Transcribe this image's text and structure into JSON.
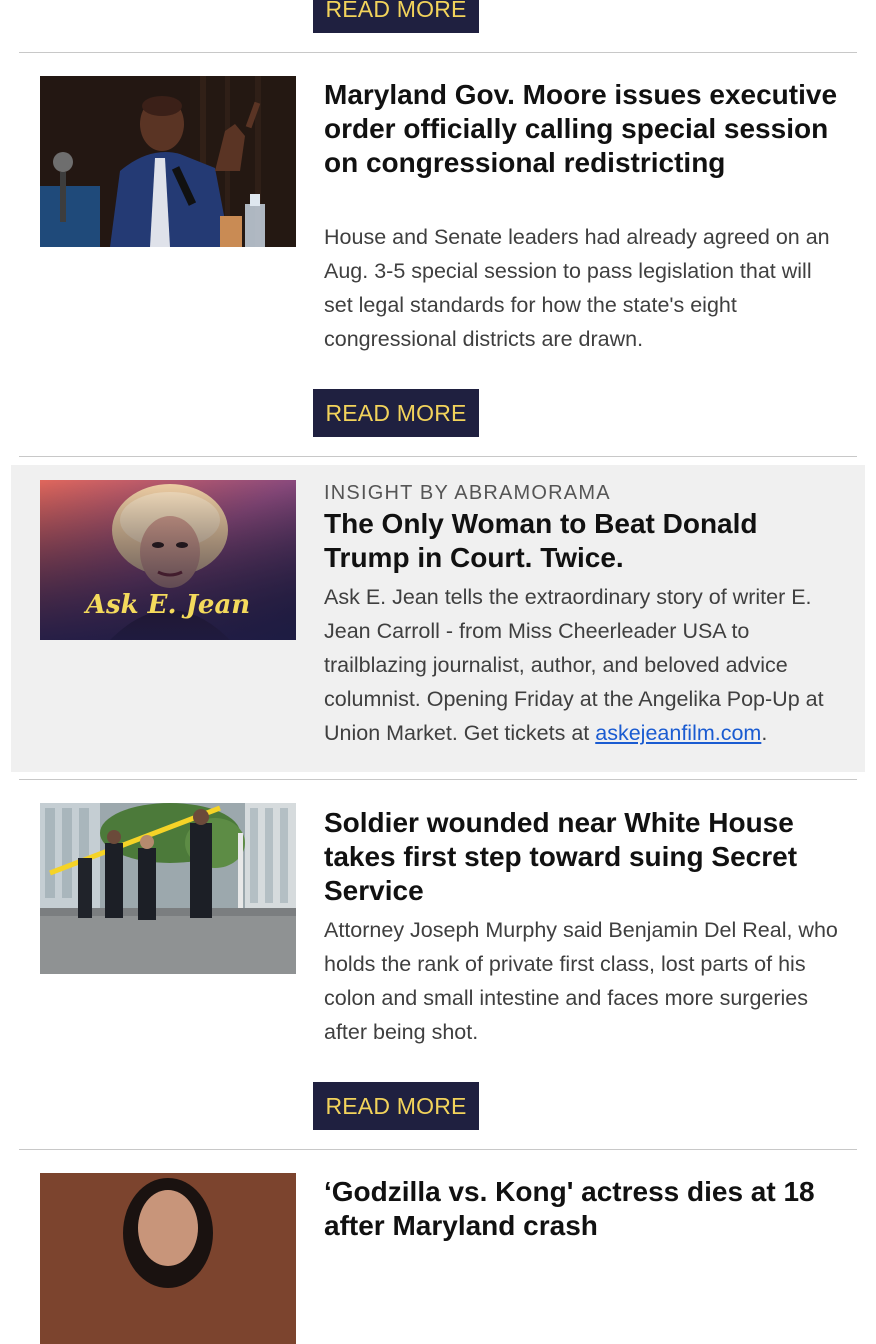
{
  "buttons": {
    "read_more": "READ MORE"
  },
  "stories": [
    {
      "headline": "Maryland Gov. Moore issues executive order officially calling special session on congressional redistricting",
      "summary": "House and Senate leaders had already agreed on an Aug. 3-5 special session to pass legislation that will set legal standards for how the state's eight congressional districts are drawn.",
      "image_icon": "portrait-photo"
    },
    {
      "headline": "Soldier wounded near White House takes first step toward suing Secret Service",
      "summary": "Attorney Joseph Murphy said Benjamin Del Real, who holds the rank of private first class, lost parts of his colon and small intestine and faces more surgeries after being shot.",
      "image_icon": "street-scene-photo"
    },
    {
      "headline": "‘Godzilla vs. Kong' actress dies at 18 after Maryland crash",
      "image_icon": "portrait-photo"
    }
  ],
  "sponsored": {
    "kicker": "INSIGHT BY ABRAMORAMA",
    "headline": "The Only Woman to Beat Donald Trump in Court. Twice.",
    "summary_text": "Ask E. Jean tells the extraordinary story of writer E. Jean Carroll - from Miss Cheerleader USA to trailblazing journalist, author, and beloved advice columnist. Opening Friday at the Angelika Pop-Up at Union Market. Get tickets at ",
    "link_text": "askejeanfilm.com",
    "summary_end": ".",
    "image_title": "Ask E. Jean"
  },
  "colors": {
    "button_bg": "#1f2040",
    "button_text": "#f2d35b",
    "link": "#1a5bd1",
    "sponsored_bg": "#f0f0f0"
  }
}
